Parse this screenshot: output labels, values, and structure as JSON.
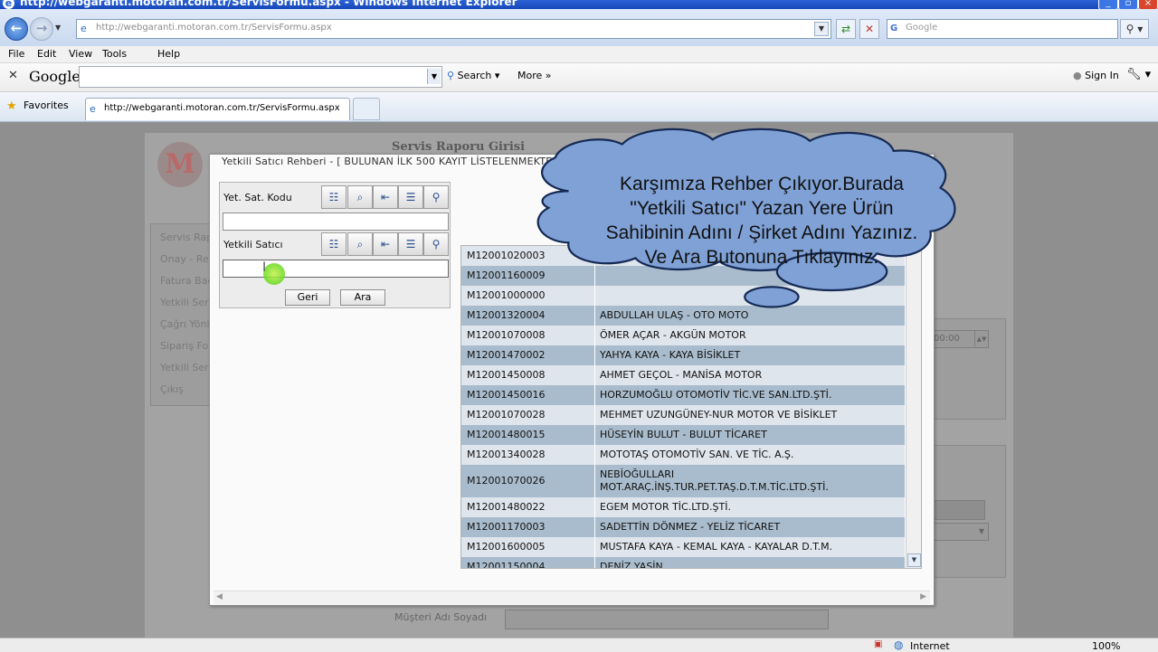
{
  "window": {
    "title": "http://webgaranti.motoran.com.tr/ServisFormu.aspx - Windows Internet Explorer"
  },
  "address_bar": {
    "url": "http://webgaranti.motoran.com.tr/ServisFormu.aspx",
    "search_placeholder": "Google"
  },
  "menu": [
    "File",
    "Edit",
    "View",
    "Tools",
    "Help"
  ],
  "google_toolbar": {
    "logo": "Google",
    "search_label": "Search",
    "more_label": "More",
    "sign_in_label": "Sign In"
  },
  "favorites_bar": {
    "favorites_label": "Favorites",
    "tab_title": "http://webgaranti.motoran.com.tr/ServisFormu.aspx"
  },
  "page": {
    "title": "Servis Raporu Girisi",
    "left_menu": [
      "Servis Rap",
      "Onay - Re",
      "Fatura Bağ",
      "Yetkili Ser",
      "Çağrı Yönl",
      "Sipariş For",
      "Yetkili Ser",
      "Çıkış"
    ],
    "time_value": "00:00",
    "customer_label": "Müşteri Adı Soyadı"
  },
  "modal": {
    "title": "Yetkili Satıcı Rehberi - [ BULUNAN İLK 500 KAYIT LİSTELENMEKTEDİR ]",
    "field1_label": "Yet. Sat. Kodu",
    "field2_label": "Yetkili Satıcı",
    "back_button": "Geri",
    "search_button": "Ara"
  },
  "results": [
    {
      "code": "M12001020003",
      "name": ""
    },
    {
      "code": "M12001160009",
      "name": ""
    },
    {
      "code": "M12001000000",
      "name": ""
    },
    {
      "code": "M12001320004",
      "name": "ABDULLAH ULAŞ - OTO MOTO"
    },
    {
      "code": "M12001070008",
      "name": "ÖMER AÇAR - AKGÜN MOTOR"
    },
    {
      "code": "M12001470002",
      "name": "YAHYA KAYA - KAYA BİSİKLET"
    },
    {
      "code": "M12001450008",
      "name": "AHMET GEÇOL - MANİSA MOTOR"
    },
    {
      "code": "M12001450016",
      "name": "HORZUMOĞLU OTOMOTİV TİC.VE SAN.LTD.ŞTİ."
    },
    {
      "code": "M12001070028",
      "name": "MEHMET UZUNGÜNEY-NUR MOTOR VE BİSİKLET"
    },
    {
      "code": "M12001480015",
      "name": "HÜSEYİN BULUT - BULUT TİCARET"
    },
    {
      "code": "M12001340028",
      "name": "MOTOTAŞ OTOMOTİV SAN. VE TİC. A.Ş."
    },
    {
      "code": "M12001070026",
      "name": "NEBİOĞULLARI",
      "name2": "MOT.ARAÇ.İNŞ.TUR.PET.TAŞ.D.T.M.TİC.LTD.ŞTİ."
    },
    {
      "code": "M12001480022",
      "name": "EGEM MOTOR TİC.LTD.ŞTİ."
    },
    {
      "code": "M12001170003",
      "name": "SADETTİN DÖNMEZ - YELİZ TİCARET"
    },
    {
      "code": "M12001600005",
      "name": "MUSTAFA KAYA - KEMAL KAYA - KAYALAR D.T.M."
    },
    {
      "code": "M12001150004",
      "name": "DENİZ YASİN"
    }
  ],
  "callout": {
    "lines": [
      "Karşımıza Rehber Çıkıyor.Burada",
      "\"Yetkili Satıcı\" Yazan Yere Ürün",
      "Sahibinin Adını /  Şirket Adını Yazınız.",
      "Ve Ara Butonuna Tıklayınız."
    ]
  },
  "status_bar": {
    "zone": "Internet",
    "zoom": "100%"
  },
  "colors": {
    "row_light": "#dfe5ec",
    "row_dark": "#a9bccd",
    "cloud_fill": "#7fa1d6",
    "cloud_stroke": "#152a55"
  },
  "icons": [
    "ie-icon",
    "back-icon",
    "forward-icon",
    "refresh-icon",
    "stop-icon",
    "search-icon",
    "star-icon",
    "wrench-icon",
    "globe-icon",
    "security-icon"
  ]
}
